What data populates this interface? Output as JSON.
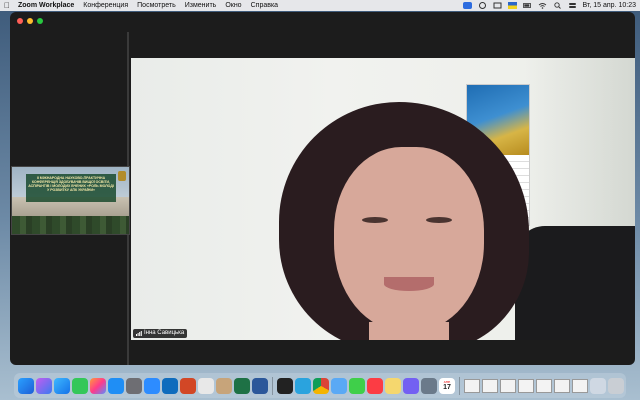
{
  "menubar": {
    "app_name": "Zoom Workplace",
    "menus": [
      "Конференция",
      "Посмотреть",
      "Изменить",
      "Окно",
      "Справка"
    ],
    "clock": "Вт, 15 апр.  10:23"
  },
  "main_video": {
    "participant_name": "Інна Савицька"
  },
  "thumbnail": {
    "banner_text": "IІ МІЖНАРОДНА НАУКОВО-ПРАКТИЧНА КОНФЕРЕНЦІЯ ЗДОБУВАЧІВ ВИЩОЇ ОСВІТИ, АСПІРАНТІВ І МОЛОДИХ ВЧЕНИХ «РОЛЬ МОЛОДІ У РОЗВИТКУ АПК УКРАЇНИ»"
  },
  "dock": {
    "calendar_day": "17",
    "calendar_month": "АПР."
  }
}
